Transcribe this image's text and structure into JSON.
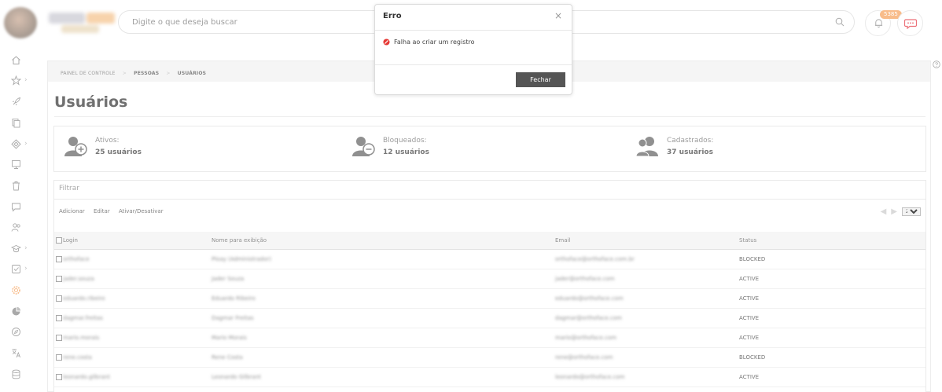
{
  "header": {
    "search_placeholder": "Digite o que deseja buscar",
    "notifications_badge": "5385"
  },
  "sidebar": {
    "items": [
      {
        "icon": "home-icon",
        "has_submenu": false
      },
      {
        "icon": "star-icon",
        "has_submenu": true
      },
      {
        "icon": "rocket-icon",
        "has_submenu": false
      },
      {
        "icon": "copy-icon",
        "has_submenu": false
      },
      {
        "icon": "puzzle-icon",
        "has_submenu": true
      },
      {
        "icon": "monitor-icon",
        "has_submenu": false
      },
      {
        "icon": "trash-icon",
        "has_submenu": false
      },
      {
        "icon": "message-icon",
        "has_submenu": false
      },
      {
        "icon": "users-icon",
        "has_submenu": false
      },
      {
        "icon": "graduation-icon",
        "has_submenu": true
      },
      {
        "icon": "checkbox-icon",
        "has_submenu": true
      },
      {
        "icon": "gear-icon",
        "has_submenu": false,
        "active": true
      },
      {
        "icon": "chart-icon",
        "has_submenu": false
      },
      {
        "icon": "compass-icon",
        "has_submenu": false
      },
      {
        "icon": "translate-icon",
        "has_submenu": false
      },
      {
        "icon": "database-icon",
        "has_submenu": false
      }
    ],
    "arrow": "›"
  },
  "breadcrumb": {
    "items": [
      "PAINEL DE CONTROLE",
      "PESSOAS",
      "USUÁRIOS"
    ],
    "separator": ">"
  },
  "page": {
    "title": "Usuários"
  },
  "stats": {
    "active": {
      "label": "Ativos:",
      "value": "25 usuários"
    },
    "blocked": {
      "label": "Bloqueados:",
      "value": "12 usuários"
    },
    "registered": {
      "label": "Cadastrados:",
      "value": "37 usuários"
    }
  },
  "filter": {
    "placeholder": "Filtrar"
  },
  "toolbar": {
    "add": "Adicionar",
    "edit": "Editar",
    "toggle": "Ativar/Desativar"
  },
  "pager": {
    "page_size": "20"
  },
  "table": {
    "columns": [
      "Login",
      "Nome para exibição",
      "Email",
      "Status"
    ],
    "rows": [
      {
        "login": "orthoface",
        "name": "Ploay (Administrador)",
        "email": "orthoface@orthoface.com.br",
        "status": "BLOCKED"
      },
      {
        "login": "jader.souza",
        "name": "Jader Souza",
        "email": "jader@orthoface.com",
        "status": "ACTIVE"
      },
      {
        "login": "eduardo.ribeiro",
        "name": "Eduardo Ribeiro",
        "email": "eduardo@orthoface.com",
        "status": "ACTIVE"
      },
      {
        "login": "dagmar.freitas",
        "name": "Dagmar Freitas",
        "email": "dagmar@orthoface.com",
        "status": "ACTIVE"
      },
      {
        "login": "mario.morais",
        "name": "Mario Morais",
        "email": "mario@orthoface.com",
        "status": "ACTIVE"
      },
      {
        "login": "rene.costa",
        "name": "Rene Costa",
        "email": "rene@orthoface.com",
        "status": "BLOCKED"
      },
      {
        "login": "leonardo.gilbrant",
        "name": "Leonardo Gilbrant",
        "email": "leonardo@orthoface.com",
        "status": "ACTIVE"
      }
    ]
  },
  "modal": {
    "title": "Erro",
    "close": "×",
    "message": "Falha ao criar um registro",
    "button": "Fechar"
  },
  "colors": {
    "accent": "#f5a25d",
    "error": "#e53935",
    "button_dark": "#555555"
  }
}
